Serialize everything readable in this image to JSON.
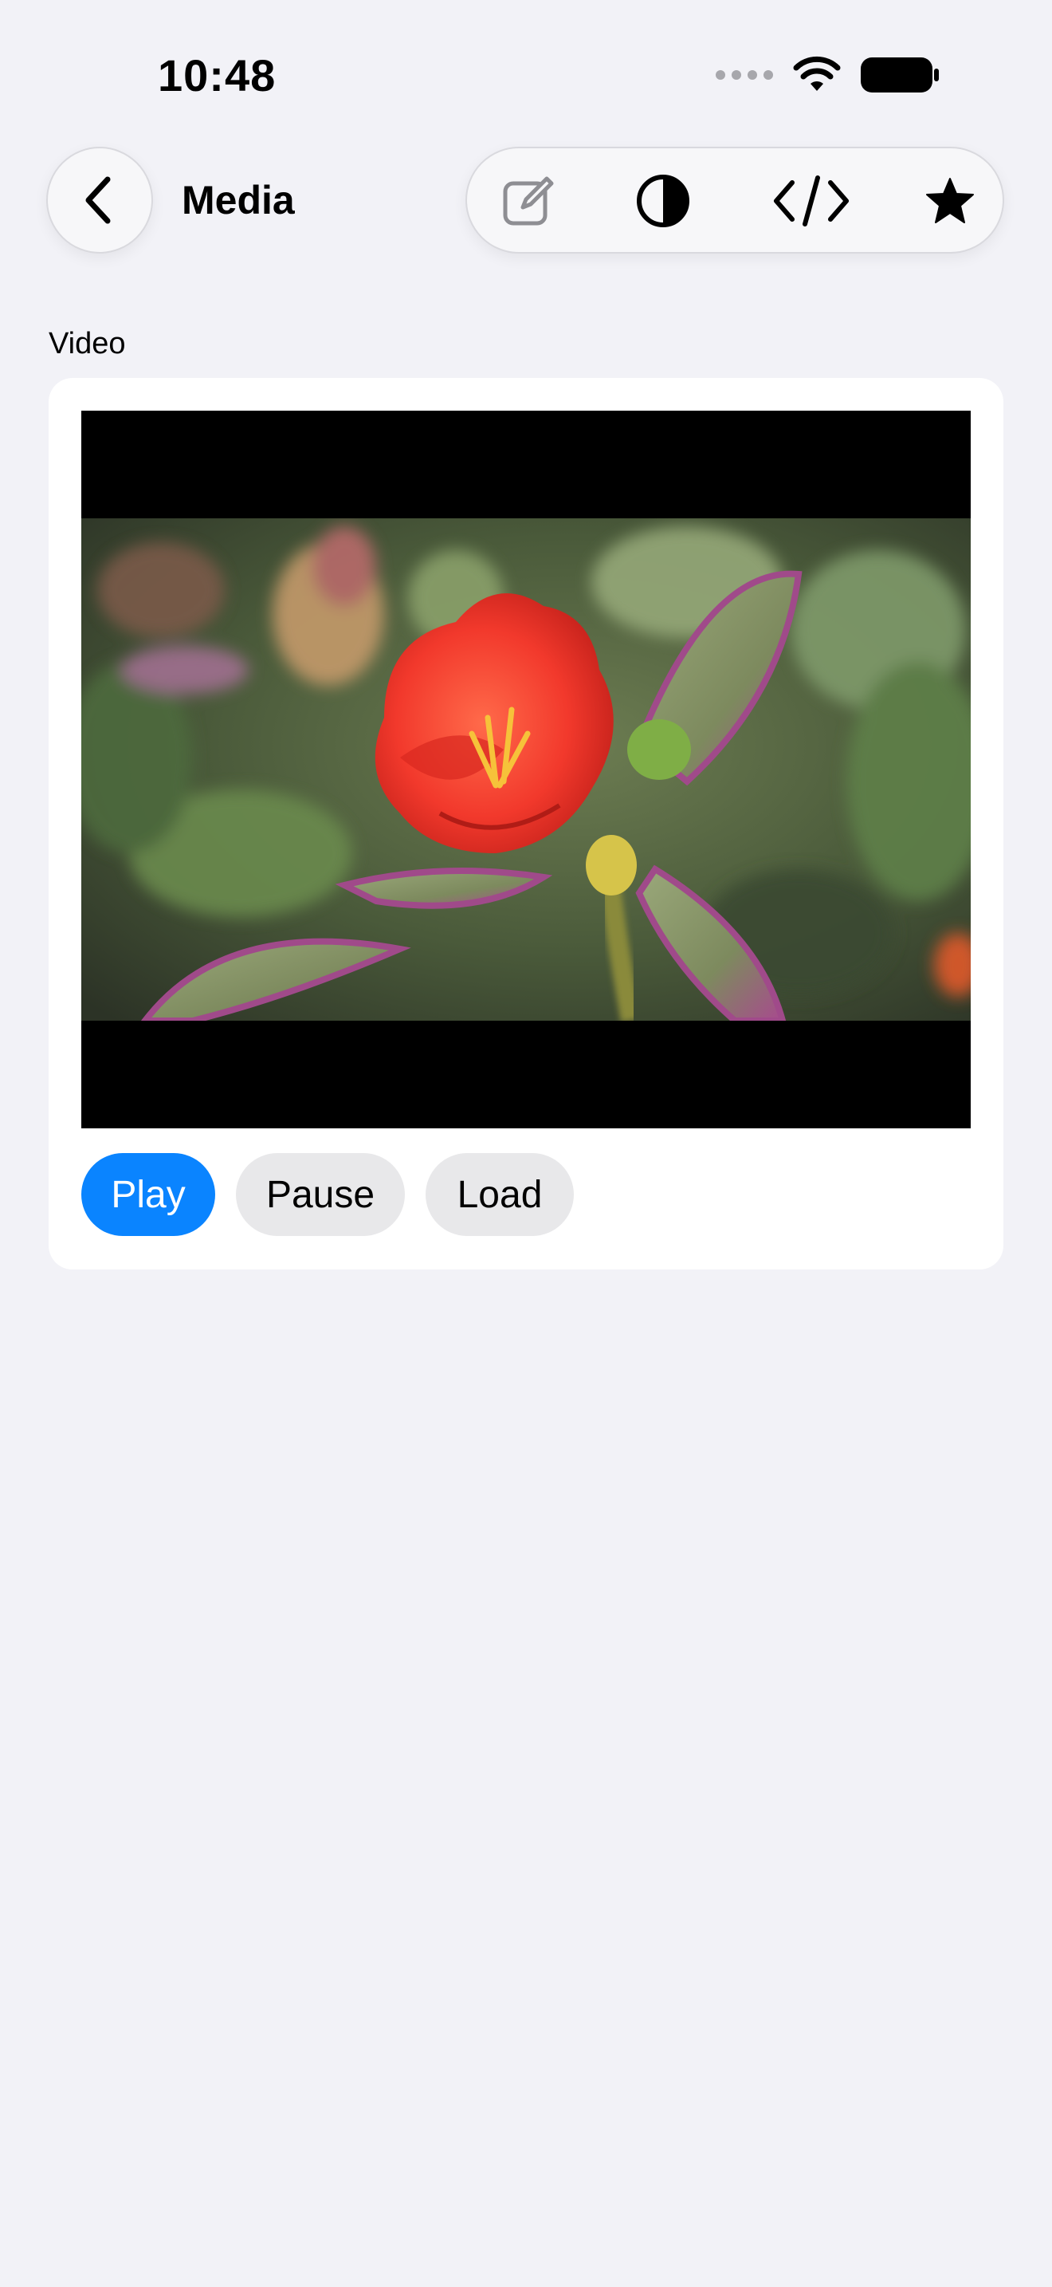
{
  "status_bar": {
    "time": "10:48"
  },
  "nav": {
    "title": "Media",
    "back_icon": "chevron-left-icon",
    "toolbar_icons": [
      "edit-icon",
      "contrast-icon",
      "code-icon",
      "star-icon"
    ]
  },
  "section": {
    "label": "Video"
  },
  "video": {
    "thumbnail_description": "red-flower-video-frame"
  },
  "controls": {
    "play_label": "Play",
    "pause_label": "Pause",
    "load_label": "Load"
  },
  "colors": {
    "accent": "#0a84ff",
    "background": "#f2f2f7",
    "card": "#ffffff",
    "secondary_button": "#e8e8ea"
  }
}
